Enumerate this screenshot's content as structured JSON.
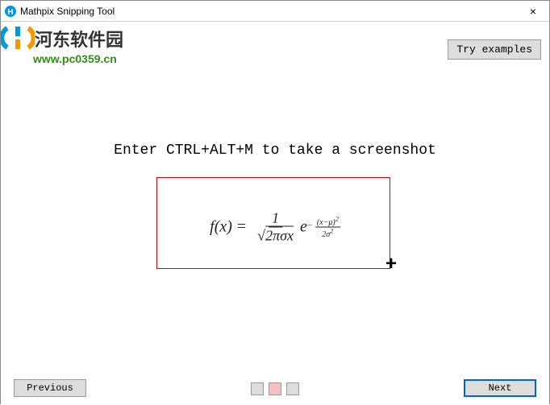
{
  "window": {
    "title": "Mathpix Snipping Tool"
  },
  "watermark": {
    "site_name": "河东软件园",
    "url": "www.pc0359.cn"
  },
  "buttons": {
    "try_examples": "Try examples",
    "previous": "Previous",
    "next": "Next",
    "close": "×"
  },
  "instruction_text": "Enter CTRL+ALT+M to take a screenshot",
  "formula": {
    "lhs": "f(x)",
    "equals": "=",
    "frac_num": "1",
    "frac_den_sqrt": "√",
    "frac_den_inner": "2πσx",
    "e": "e",
    "exp_neg": "−",
    "exp_num": "(x−μ)",
    "exp_num_pow": "2",
    "exp_den": "2σ",
    "exp_den_pow": "2"
  },
  "pagination": {
    "total": 3,
    "active": 2
  }
}
